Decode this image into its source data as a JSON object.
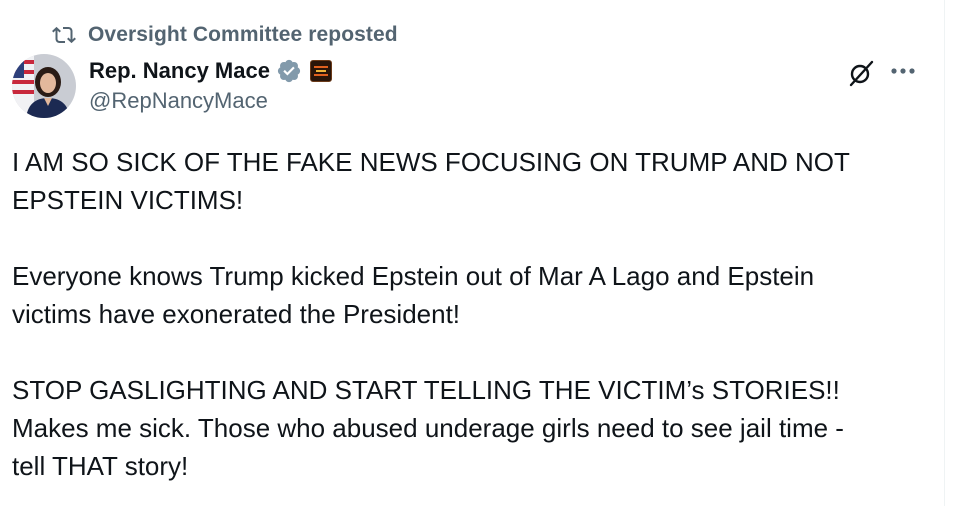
{
  "repost": {
    "icon": "repost-icon",
    "text": "Oversight Committee reposted"
  },
  "author": {
    "avatar": "avatar",
    "display_name": "Rep. Nancy Mace",
    "handle": "@RepNancyMace",
    "verified_icon": "verified-badge-icon",
    "affiliate_badge": "affiliate-badge-icon"
  },
  "actions": {
    "grok_icon": "grok-icon",
    "more_icon": "more-icon"
  },
  "post": {
    "paragraphs": [
      "I AM SO SICK OF THE FAKE NEWS FOCUSING ON TRUMP AND NOT\nEPSTEIN VICTIMS!",
      "Everyone knows Trump kicked Epstein out of Mar A Lago and Epstein\nvictims have exonerated the President!",
      "STOP GASLIGHTING AND START TELLING THE VICTIM’s STORIES!!\nMakes me sick. Those who abused underage girls need to see jail time -\ntell THAT story!"
    ]
  },
  "colors": {
    "text_primary": "#0f1419",
    "text_secondary": "#536471",
    "verified_fill": "#829aab",
    "divider": "#eff3f4"
  }
}
